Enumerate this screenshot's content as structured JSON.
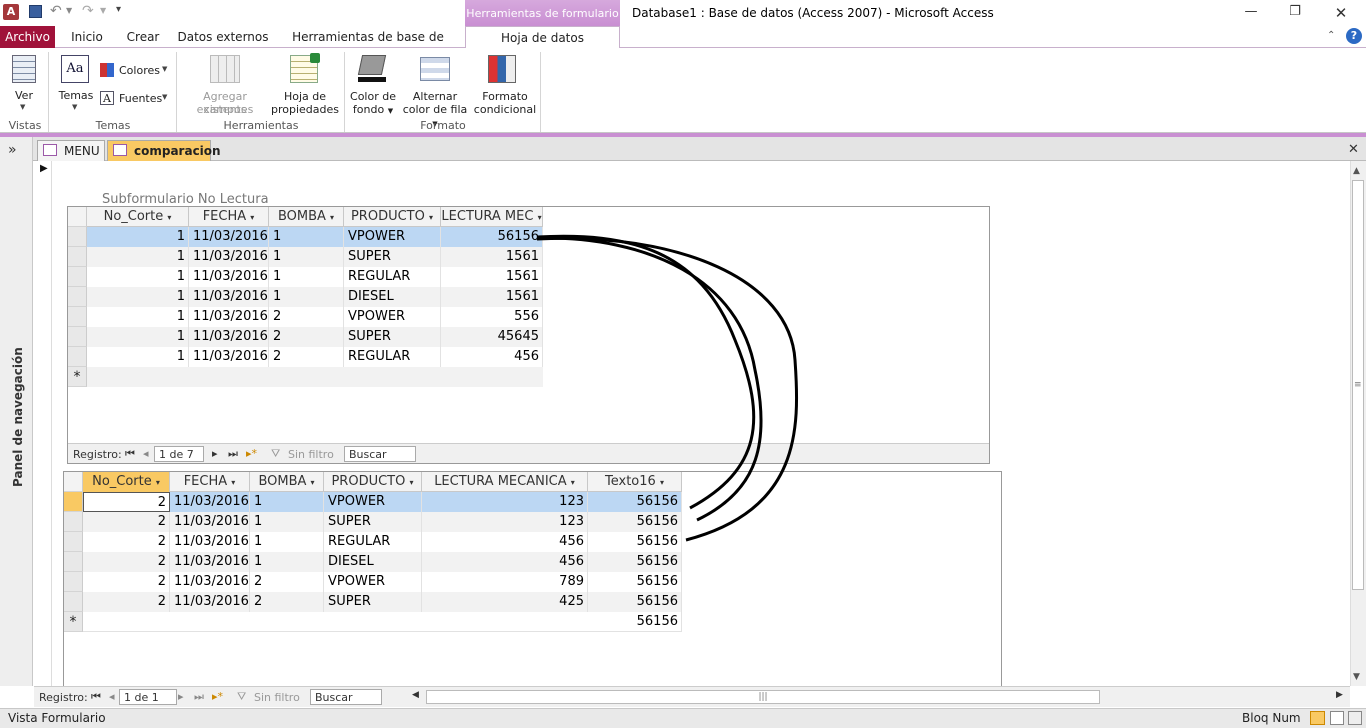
{
  "window": {
    "title": "Database1 : Base de datos (Access 2007)  -  Microsoft Access",
    "context_tab_header": "Herramientas de formulario",
    "app_icon_letter": "A"
  },
  "ribbon_tabs": [
    "Archivo",
    "Inicio",
    "Crear",
    "Datos externos",
    "Herramientas de base de datos",
    "Hoja de datos"
  ],
  "ribbon": {
    "vistas": {
      "label": "Vistas",
      "ver": "Ver"
    },
    "temas": {
      "label": "Temas",
      "temas_btn": "Temas",
      "colores": "Colores",
      "fuentes": "Fuentes"
    },
    "herramientas": {
      "label": "Herramientas",
      "agregar_1": "Agregar campos",
      "agregar_2": "existentes",
      "hoja_1": "Hoja de",
      "hoja_2": "propiedades"
    },
    "formato": {
      "label": "Formato",
      "color_1": "Color de",
      "color_2": "fondo",
      "alternar_1": "Alternar",
      "alternar_2": "color de fila",
      "formato_1": "Formato",
      "formato_2": "condicional"
    }
  },
  "nav_pane": {
    "label": "Panel de navegación",
    "expand": "»"
  },
  "doc_tabs": [
    "MENU",
    "comparacion"
  ],
  "subform1": {
    "caption": "Subformulario No Lectura",
    "headers": [
      "No_Corte",
      "FECHA",
      "BOMBA",
      "PRODUCTO",
      "LECTURA MEC"
    ],
    "rows": [
      [
        "1",
        "11/03/2016",
        "1",
        "VPOWER",
        "56156"
      ],
      [
        "1",
        "11/03/2016",
        "1",
        "SUPER",
        "1561"
      ],
      [
        "1",
        "11/03/2016",
        "1",
        "REGULAR",
        "1561"
      ],
      [
        "1",
        "11/03/2016",
        "1",
        "DIESEL",
        "1561"
      ],
      [
        "1",
        "11/03/2016",
        "2",
        "VPOWER",
        "556"
      ],
      [
        "1",
        "11/03/2016",
        "2",
        "SUPER",
        "45645"
      ],
      [
        "1",
        "11/03/2016",
        "2",
        "REGULAR",
        "456"
      ]
    ],
    "nav": {
      "registro": "Registro:",
      "position": "1 de 7",
      "filter": "Sin filtro",
      "search": "Buscar"
    }
  },
  "subform2": {
    "headers": [
      "No_Corte",
      "FECHA",
      "BOMBA",
      "PRODUCTO",
      "LECTURA MECANICA",
      "Texto16"
    ],
    "rows": [
      [
        "2",
        "11/03/2016",
        "1",
        "VPOWER",
        "123",
        "56156"
      ],
      [
        "2",
        "11/03/2016",
        "1",
        "SUPER",
        "123",
        "56156"
      ],
      [
        "2",
        "11/03/2016",
        "1",
        "REGULAR",
        "456",
        "56156"
      ],
      [
        "2",
        "11/03/2016",
        "1",
        "DIESEL",
        "456",
        "56156"
      ],
      [
        "2",
        "11/03/2016",
        "2",
        "VPOWER",
        "789",
        "56156"
      ],
      [
        "2",
        "11/03/2016",
        "2",
        "SUPER",
        "425",
        "56156"
      ]
    ],
    "new_row_texto16": "56156"
  },
  "new_record_symbol": "*",
  "bottom_nav": {
    "registro": "Registro:",
    "position": "1 de 1",
    "filter": "Sin filtro",
    "search": "Buscar"
  },
  "status": {
    "left": "Vista Formulario",
    "right": "Bloq Num"
  }
}
